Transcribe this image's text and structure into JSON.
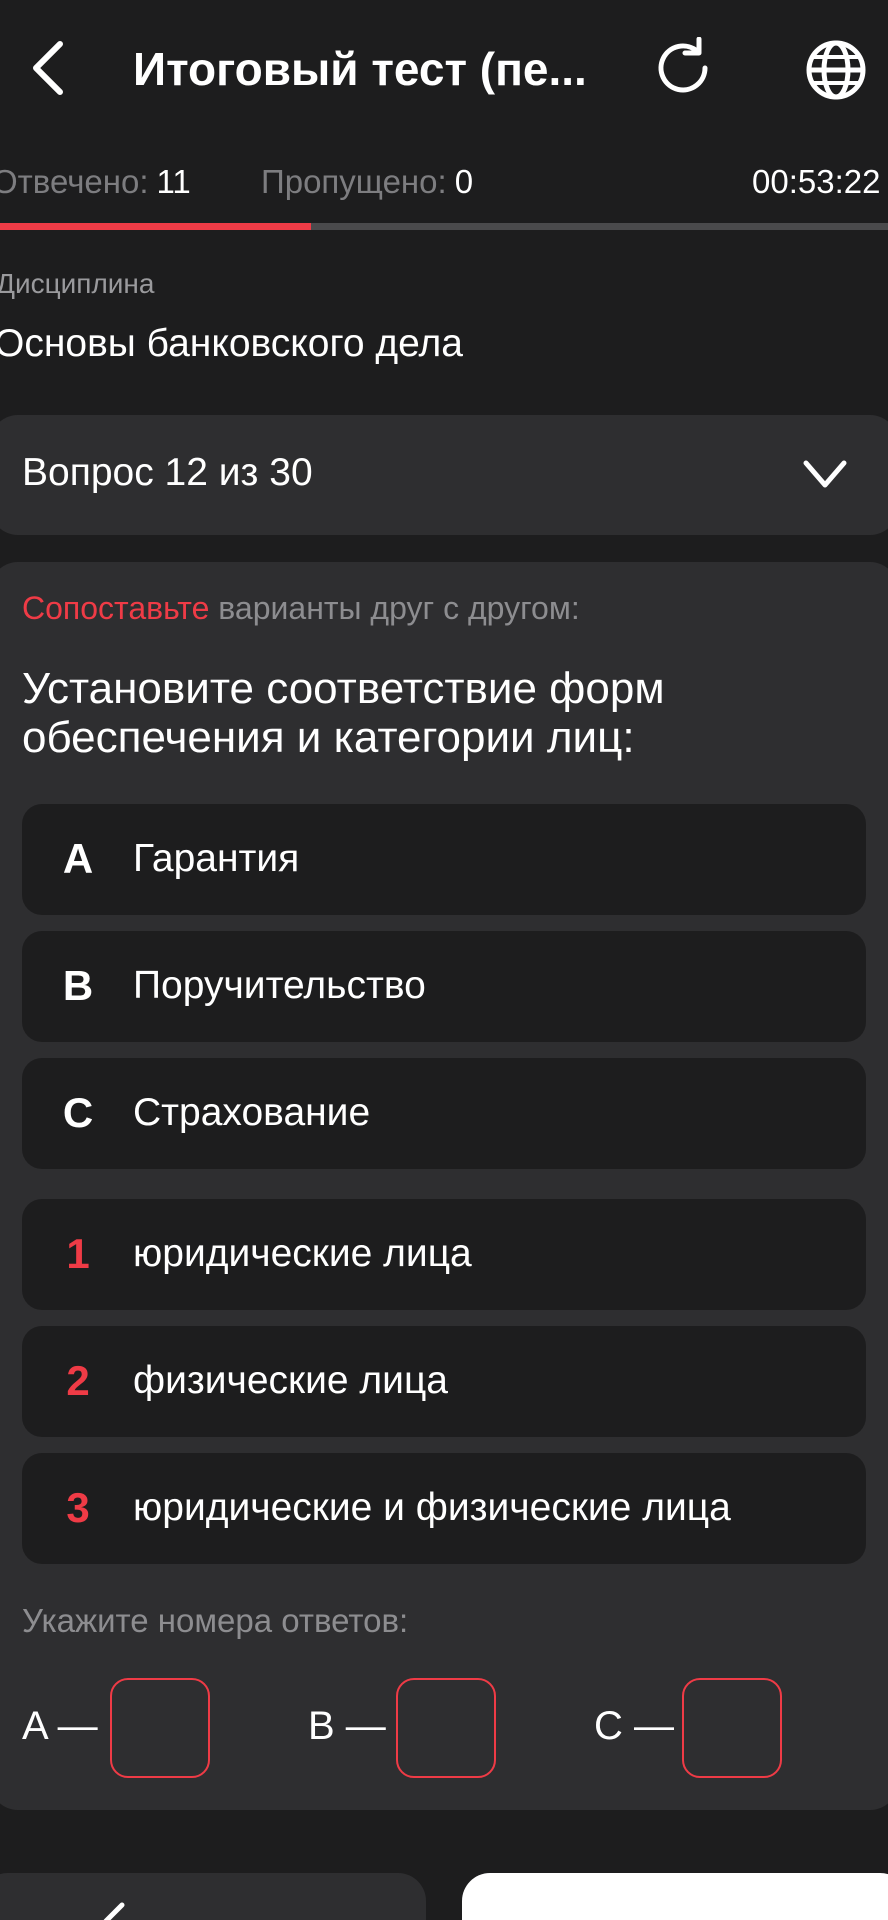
{
  "header": {
    "title": "Итоговый тест (пе...",
    "back_icon": "chevron-left-icon",
    "reload_icon": "reload-icon",
    "language_icon": "globe-icon"
  },
  "stats": {
    "answered_label": "Отвечено:",
    "answered_value": "11",
    "skipped_label": "Пропущено:",
    "skipped_value": "0",
    "timer": "00:53:22",
    "progress": 0.35
  },
  "discipline": {
    "label": "Дисциплина",
    "value": "Основы банковского дела"
  },
  "question_select": {
    "text": "Вопрос 12 из 30"
  },
  "question": {
    "instruction_accent": "Сопоставьте",
    "instruction_rest": " варианты друг с другом:",
    "text": "Установите соответствие форм обеспечения и категории лиц:",
    "left_items": [
      {
        "key": "A",
        "text": "Гарантия"
      },
      {
        "key": "B",
        "text": "Поручительство"
      },
      {
        "key": "C",
        "text": "Страхование"
      }
    ],
    "right_items": [
      {
        "key": "1",
        "text": "юридические лица"
      },
      {
        "key": "2",
        "text": "физические лица"
      },
      {
        "key": "3",
        "text": "юридические и физические лица"
      }
    ]
  },
  "answers": {
    "label": "Укажите номера ответов:",
    "fields": [
      {
        "letter": "A —",
        "value": ""
      },
      {
        "letter": "B —",
        "value": ""
      },
      {
        "letter": "C —",
        "value": ""
      }
    ]
  },
  "colors": {
    "accent": "#ef3b46",
    "background": "#1d1d1e",
    "card": "#2e2e30"
  }
}
